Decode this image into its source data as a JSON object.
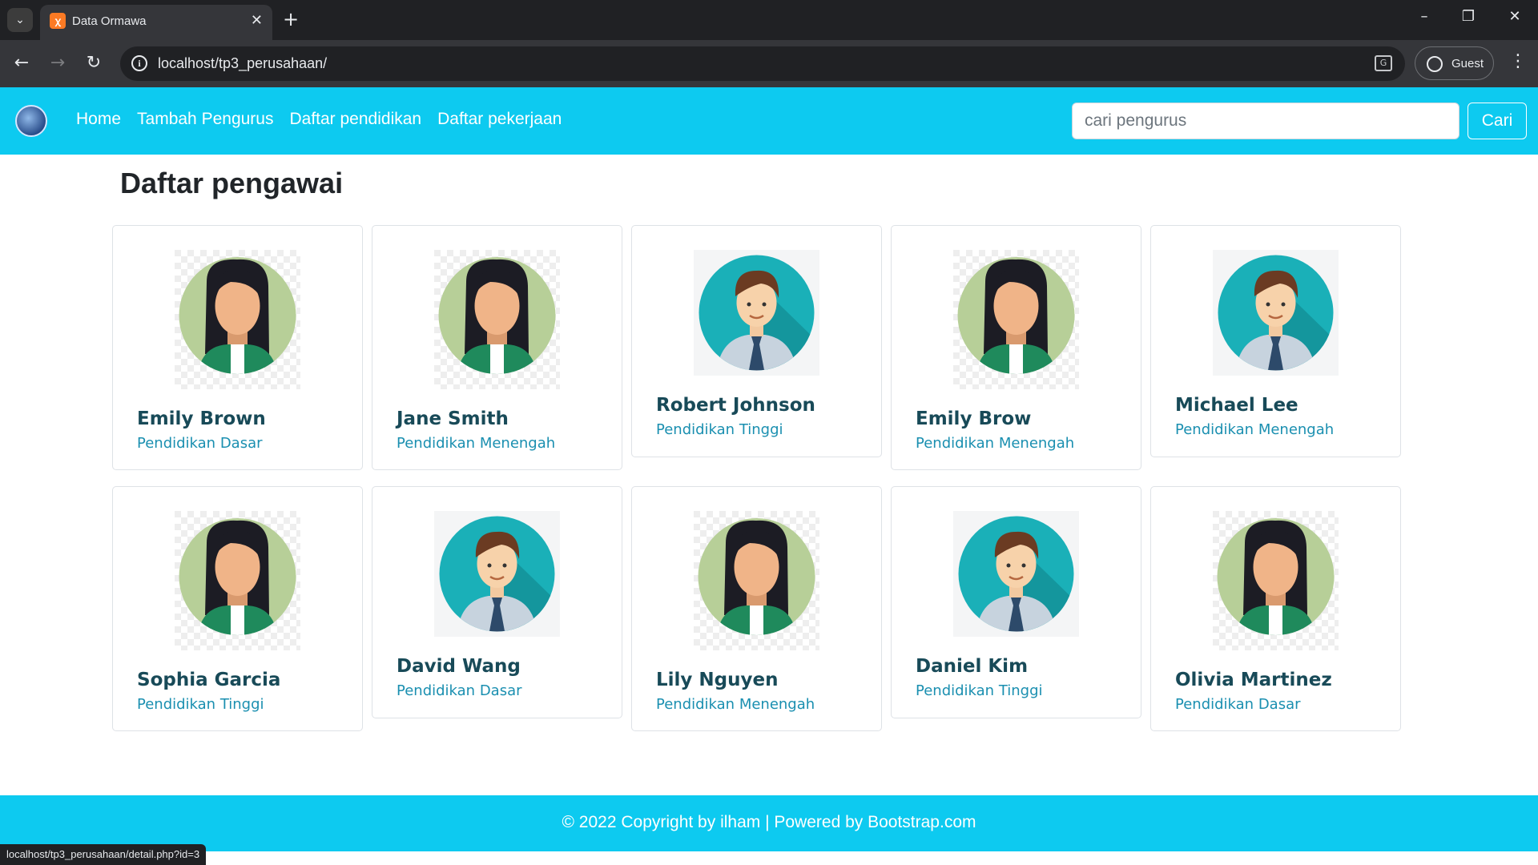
{
  "browser": {
    "tab_title": "Data Ormawa",
    "url": "localhost/tp3_perusahaan/",
    "profile_label": "Guest",
    "status_url": "localhost/tp3_perusahaan/detail.php?id=3"
  },
  "navbar": {
    "links": [
      "Home",
      "Tambah Pengurus",
      "Daftar pendidikan",
      "Daftar pekerjaan"
    ],
    "search_placeholder": "cari pengurus",
    "search_button": "Cari"
  },
  "main": {
    "title": "Daftar pengawai",
    "cards": [
      {
        "name": "Emily Brown",
        "education": "Pendidikan Dasar",
        "avatar": "female-avatar-icon"
      },
      {
        "name": "Jane Smith",
        "education": "Pendidikan Menengah",
        "avatar": "female-avatar-icon"
      },
      {
        "name": "Robert Johnson",
        "education": "Pendidikan Tinggi",
        "avatar": "male-avatar-icon"
      },
      {
        "name": "Emily Brow",
        "education": "Pendidikan Menengah",
        "avatar": "female-avatar-icon"
      },
      {
        "name": "Michael Lee",
        "education": "Pendidikan Menengah",
        "avatar": "male-avatar-icon"
      },
      {
        "name": "Sophia Garcia",
        "education": "Pendidikan Tinggi",
        "avatar": "female-avatar-icon"
      },
      {
        "name": "David Wang",
        "education": "Pendidikan Dasar",
        "avatar": "male-avatar-icon"
      },
      {
        "name": "Lily Nguyen",
        "education": "Pendidikan Menengah",
        "avatar": "female-avatar-icon"
      },
      {
        "name": "Daniel Kim",
        "education": "Pendidikan Tinggi",
        "avatar": "male-avatar-icon"
      },
      {
        "name": "Olivia Martinez",
        "education": "Pendidikan Dasar",
        "avatar": "female-avatar-icon"
      }
    ]
  },
  "footer": {
    "text": "© 2022 Copyright by ilham  |  Powered by Bootstrap.com"
  },
  "colors": {
    "primary": "#0dcaf0",
    "name_text": "#184a58",
    "education_text": "#1a8fb0"
  }
}
